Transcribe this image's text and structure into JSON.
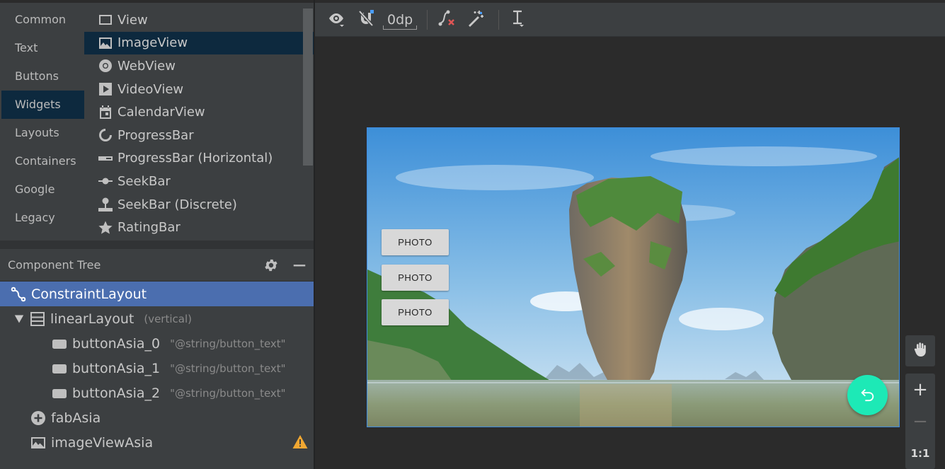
{
  "palette": {
    "categories": [
      {
        "label": "Common"
      },
      {
        "label": "Text"
      },
      {
        "label": "Buttons"
      },
      {
        "label": "Widgets",
        "selected": true
      },
      {
        "label": "Layouts"
      },
      {
        "label": "Containers"
      },
      {
        "label": "Google"
      },
      {
        "label": "Legacy"
      }
    ],
    "items": [
      {
        "label": "View",
        "icon": "view-icon"
      },
      {
        "label": "ImageView",
        "icon": "image-icon",
        "selected": true
      },
      {
        "label": "WebView",
        "icon": "webview-icon"
      },
      {
        "label": "VideoView",
        "icon": "video-icon"
      },
      {
        "label": "CalendarView",
        "icon": "calendar-icon"
      },
      {
        "label": "ProgressBar",
        "icon": "progress-icon"
      },
      {
        "label": "ProgressBar (Horizontal)",
        "icon": "progress-horizontal-icon"
      },
      {
        "label": "SeekBar",
        "icon": "seekbar-icon"
      },
      {
        "label": "SeekBar (Discrete)",
        "icon": "seekbar-discrete-icon"
      },
      {
        "label": "RatingBar",
        "icon": "star-icon"
      }
    ]
  },
  "tree": {
    "title": "Component Tree",
    "nodes": [
      {
        "label": "ConstraintLayout",
        "icon": "constraint-layout-icon",
        "selected": true
      },
      {
        "label": "linearLayout",
        "sub": "(vertical)",
        "icon": "linear-layout-icon"
      },
      {
        "label": "buttonAsia_0",
        "sub": "\"@string/button_text\"",
        "icon": "button-icon"
      },
      {
        "label": "buttonAsia_1",
        "sub": "\"@string/button_text\"",
        "icon": "button-icon"
      },
      {
        "label": "buttonAsia_2",
        "sub": "\"@string/button_text\"",
        "icon": "button-icon"
      },
      {
        "label": "fabAsia",
        "icon": "fab-icon"
      },
      {
        "label": "imageViewAsia",
        "icon": "image-icon",
        "warning": true
      }
    ]
  },
  "toolbar": {
    "margin_value": "0dp"
  },
  "canvas": {
    "buttons": [
      {
        "label": "PHOTO"
      },
      {
        "label": "PHOTO"
      },
      {
        "label": "PHOTO"
      }
    ],
    "accent": "#1de9b6",
    "selection_color": "#3d8be0"
  },
  "zoom": {
    "zoom_in": "+",
    "zoom_out": "−",
    "reset": "1:1"
  }
}
